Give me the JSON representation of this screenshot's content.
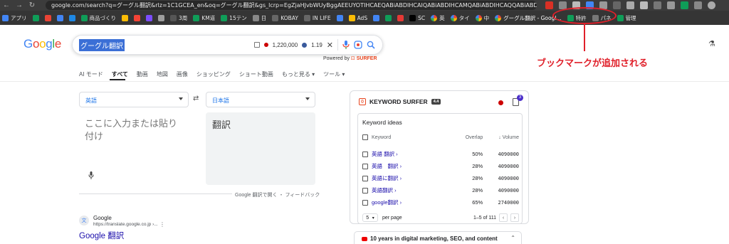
{
  "browser": {
    "url": "google.com/search?q=グーグル翻訳&rlz=1C1GCEA_en&oq=グーグル翻訳&gs_lcrp=EgZjaHJvbWUyBggAEEUYOTIHCAEQABiABDIHCAIQABiABDIHCAMQABiABDIHCAQQABiABDIHCAUQABiABDIH..."
  },
  "bookmarks": [
    {
      "label": "アプリ",
      "color": "#4285f4"
    },
    {
      "label": "",
      "color": "#0f9d58"
    },
    {
      "label": "",
      "color": "#ea4335"
    },
    {
      "label": "",
      "color": "#4285f4"
    },
    {
      "label": "",
      "color": "#1e88e5"
    },
    {
      "label": "商品づくり",
      "color": "#0f9d58"
    },
    {
      "label": "",
      "color": "#fbbc05"
    },
    {
      "label": "",
      "color": "#f44336"
    },
    {
      "label": "",
      "color": "#7c4dff"
    },
    {
      "label": "",
      "color": "#9e9e9e"
    },
    {
      "label": "3周",
      "color": "#555555"
    },
    {
      "label": "KM道",
      "color": "#0f9d58"
    },
    {
      "label": "15テン",
      "color": "#0f9d58"
    },
    {
      "label": "日",
      "color": "#888888"
    },
    {
      "label": "KOBAY",
      "color": "#666666"
    },
    {
      "label": "IN LIFE",
      "color": "#666666"
    },
    {
      "label": "",
      "color": "#4285f4"
    },
    {
      "label": "AdS",
      "color": "#fbbc05"
    },
    {
      "label": "",
      "color": "#4285f4"
    },
    {
      "label": "",
      "color": "#0f9d58"
    },
    {
      "label": "",
      "color": "#e53935"
    },
    {
      "label": "SC",
      "color": "#000000"
    },
    {
      "label": "英",
      "color": "#4285f4"
    },
    {
      "label": "タイ",
      "color": "#4285f4"
    },
    {
      "label": "中",
      "color": "#4285f4"
    },
    {
      "label": "グーグル翻訳 - Googl...",
      "color": "#4285f4"
    },
    {
      "label": "特許",
      "color": "#0f9d58"
    },
    {
      "label": "パネ",
      "color": "#777777"
    },
    {
      "label": "管理",
      "color": "#0f9d58"
    }
  ],
  "logo": [
    "G",
    "o",
    "o",
    "g",
    "l",
    "e"
  ],
  "search": {
    "query": "グーグル翻訳",
    "metric1": "1,220,000",
    "metric2": "1.19",
    "powered_prefix": "Powered by",
    "powered_brand": "SURFER"
  },
  "annotation": {
    "text": "ブックマークが追加される",
    "color": "#e0202a"
  },
  "tabs": {
    "ai": "AI モード",
    "all": "すべて",
    "video": "動画",
    "maps": "地図",
    "images": "画像",
    "shopping": "ショッピング",
    "shorts": "ショート動画",
    "more": "もっと見る",
    "tools": "ツール"
  },
  "translate": {
    "source_lang": "英語",
    "target_lang": "日本語",
    "source_placeholder": "ここに入力または貼り付け",
    "target_text": "翻訳",
    "footer_open": "Google 翻訳で開く",
    "footer_sep": "・",
    "footer_feedback": "フィードバック"
  },
  "result": {
    "site": "Google",
    "url": "https://translate.google.co.jp ›...",
    "title": "Google 翻訳"
  },
  "surfer": {
    "brand": "KEYWORD SURFER",
    "version": "4.4",
    "badge_count": "3",
    "card_title": "Keyword ideas",
    "col_keyword": "Keyword",
    "col_overlap": "Overlap",
    "col_volume": "↓ Volume",
    "rows": [
      {
        "keyword": "英語 翻訳 ›",
        "overlap": "50%",
        "volume": "4090000"
      },
      {
        "keyword": "英語　翻訳 ›",
        "overlap": "28%",
        "volume": "4090000"
      },
      {
        "keyword": "英語に翻訳 ›",
        "overlap": "28%",
        "volume": "4090000"
      },
      {
        "keyword": "英語翻訳 ›",
        "overlap": "28%",
        "volume": "4090000"
      },
      {
        "keyword": "google翻訳 ›",
        "overlap": "65%",
        "volume": "2740000"
      }
    ],
    "per_page_value": "5",
    "per_page_label": "per page",
    "range": "1–5 of 111",
    "banner": "10 years in digital marketing, SEO, and content"
  }
}
